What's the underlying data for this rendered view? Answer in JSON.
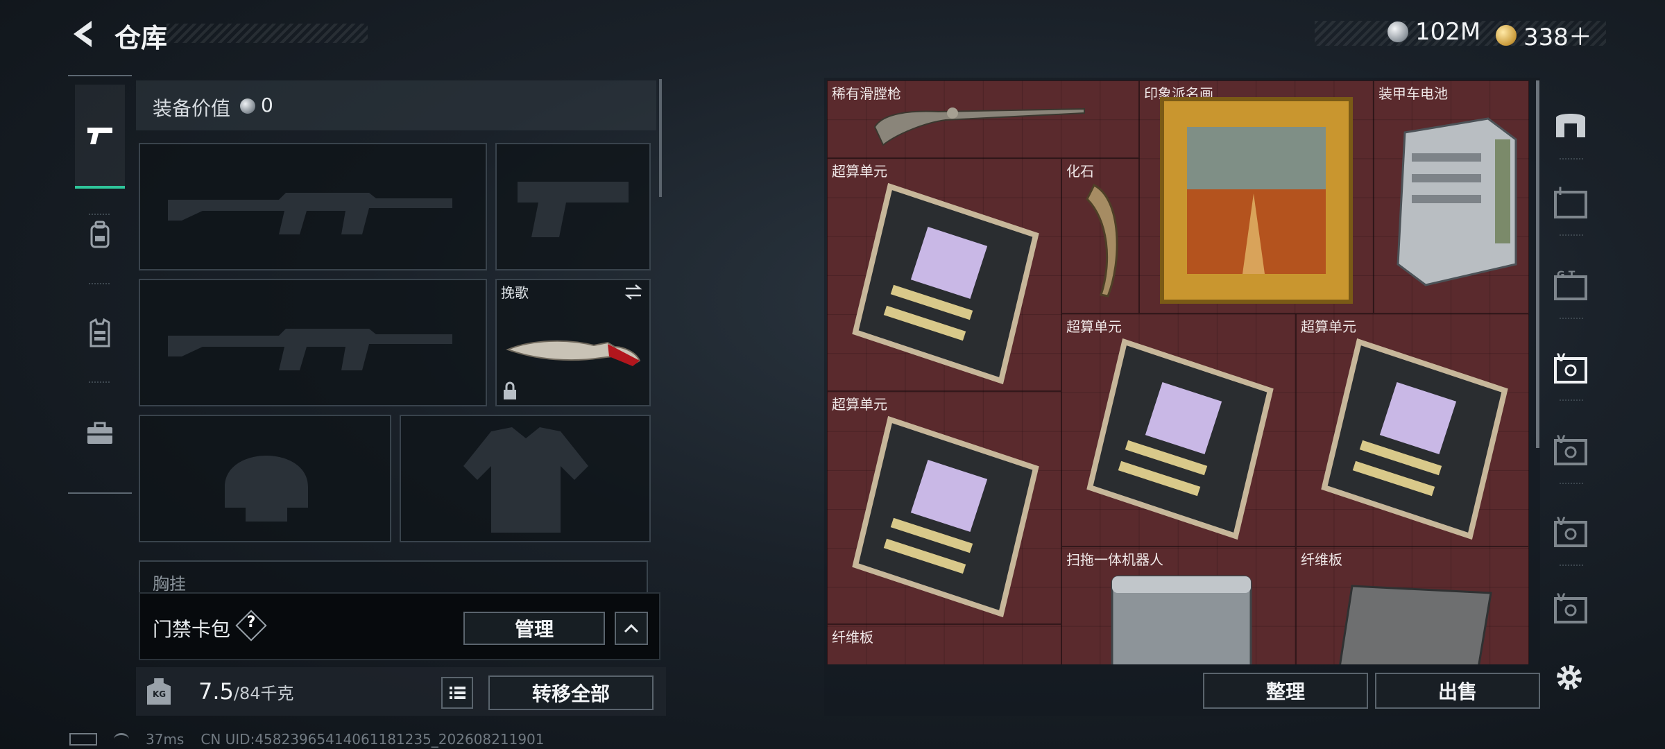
{
  "header": {
    "title": "仓库",
    "currencies": [
      {
        "icon": "silver-coin-icon",
        "value": "102M"
      },
      {
        "icon": "gold-coin-icon",
        "value": "338＋"
      }
    ]
  },
  "nav": {
    "items": [
      {
        "icon": "pistol-icon",
        "active": true
      },
      {
        "icon": "backpack-icon",
        "active": false
      },
      {
        "icon": "vest-icon",
        "active": false
      },
      {
        "icon": "briefcase-icon",
        "active": false
      }
    ]
  },
  "equipment": {
    "value_label": "装备价值",
    "value": "0",
    "melee_label": "挽歌",
    "chest_label": "胸挂"
  },
  "keycard": {
    "label": "门禁卡包",
    "help": "?",
    "manage_label": "管理"
  },
  "weight": {
    "unit_icon_text": "KG",
    "current": "7.5",
    "max": "/84千克",
    "transfer_all_label": "转移全部"
  },
  "stash": {
    "items": [
      {
        "name": "稀有滑膛枪"
      },
      {
        "name": "印象派名画"
      },
      {
        "name": "装甲车电池"
      },
      {
        "name": "超算单元"
      },
      {
        "name": "化石"
      },
      {
        "name": "超算单元"
      },
      {
        "name": "超算单元"
      },
      {
        "name": "超算单元"
      },
      {
        "name": "扫拖一体机器人"
      },
      {
        "name": "纤维板"
      },
      {
        "name": "纤维板"
      }
    ],
    "sort_label": "整理",
    "sell_label": "出售",
    "tabs": [
      {
        "icon": "stash-home-icon",
        "text": ""
      },
      {
        "icon": "stash-tab-1-icon",
        "text": "I"
      },
      {
        "icon": "stash-tab-2-icon",
        "text": "G.T."
      },
      {
        "icon": "stash-tab-3-icon",
        "text": "V"
      },
      {
        "icon": "stash-tab-4-icon",
        "text": "V"
      },
      {
        "icon": "stash-tab-5-icon",
        "text": "V"
      },
      {
        "icon": "stash-tab-6-icon",
        "text": "V"
      }
    ]
  },
  "status": {
    "ping": "37ms",
    "uid": "CN UID:45823965414061181235_202608211901"
  },
  "colors": {
    "accent": "#2fc59a",
    "stash_bg": "#5a2a2d"
  }
}
